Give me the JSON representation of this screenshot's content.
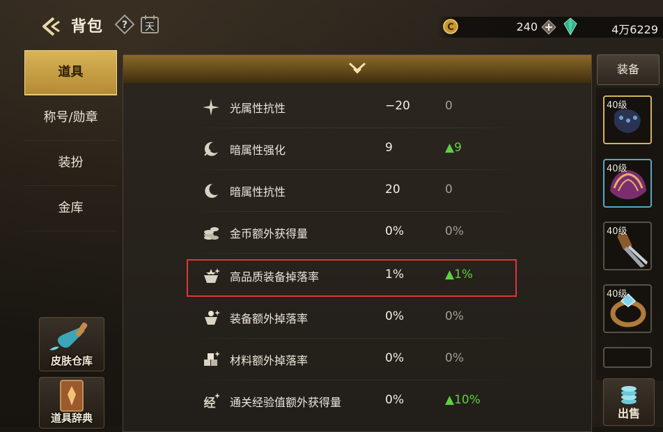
{
  "header": {
    "title": "背包",
    "calendar_label": "天",
    "gold_amount": "240",
    "gem_amount": "4万6229"
  },
  "left_nav": {
    "items": [
      {
        "label": "道具",
        "active": true
      },
      {
        "label": "称号/勋章",
        "active": false
      },
      {
        "label": "装扮",
        "active": false
      },
      {
        "label": "金库",
        "active": false
      }
    ],
    "skin_storage_label": "皮肤仓库",
    "item_dictionary_label": "道具辞典"
  },
  "stats": [
    {
      "icon": "sparkle-icon",
      "name": "光属性抗性",
      "value": "−20",
      "delta": "0",
      "up": false
    },
    {
      "icon": "dark-moon-sword-icon",
      "name": "暗属性强化",
      "value": "9",
      "delta": "▲9",
      "up": true
    },
    {
      "icon": "moon-icon",
      "name": "暗属性抗性",
      "value": "20",
      "delta": "0",
      "up": false
    },
    {
      "icon": "coin-stack-icon",
      "name": "金币额外获得量",
      "value": "0%",
      "delta": "0%",
      "up": false
    },
    {
      "icon": "quality-gear-drop-icon",
      "name": "高品质装备掉落率",
      "value": "1%",
      "delta": "▲1%",
      "up": true
    },
    {
      "icon": "gear-drop-icon",
      "name": "装备额外掉落率",
      "value": "0%",
      "delta": "0%",
      "up": false
    },
    {
      "icon": "material-drop-icon",
      "name": "材料额外掉落率",
      "value": "0%",
      "delta": "0%",
      "up": false
    },
    {
      "icon": "exp-bonus-icon",
      "name": "通关经验值额外获得量",
      "value": "0%",
      "delta": "▲10%",
      "up": true
    }
  ],
  "right_panel": {
    "equip_tab_label": "装备",
    "slots": [
      {
        "level": "40级",
        "icon": "gauntlet-icon"
      },
      {
        "level": "40级",
        "icon": "shoulder-armor-icon"
      },
      {
        "level": "40级",
        "icon": "blade-icon"
      },
      {
        "level": "40级",
        "icon": "ring-icon"
      }
    ],
    "sell_label": "出售"
  },
  "colors": {
    "accent_gold": "#d9b458",
    "up_green": "#5fd13f",
    "highlight_red": "#d8393a"
  }
}
